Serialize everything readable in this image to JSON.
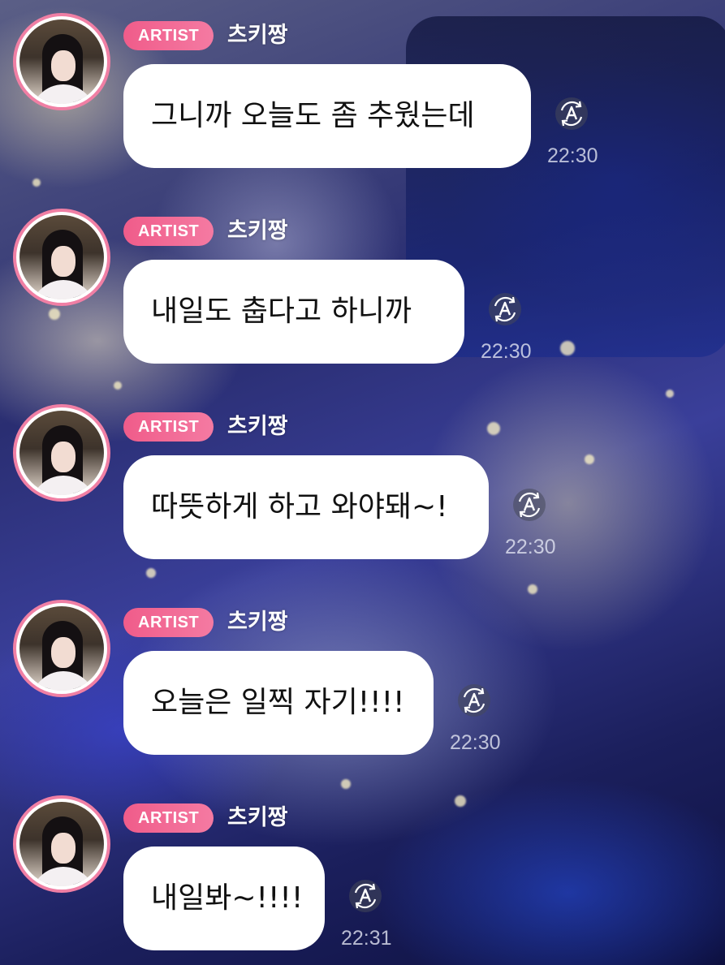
{
  "messages": [
    {
      "badge": "ARTIST",
      "name": "츠키짱",
      "text": "그니까 오늘도 좀 추웠는데",
      "time": "22:30"
    },
    {
      "badge": "ARTIST",
      "name": "츠키짱",
      "text": "내일도 춥다고 하니까",
      "time": "22:30"
    },
    {
      "badge": "ARTIST",
      "name": "츠키짱",
      "text": "따뜻하게 하고 와야돼~!",
      "time": "22:30"
    },
    {
      "badge": "ARTIST",
      "name": "츠키짱",
      "text": "오늘은 일찍 자기!!!!",
      "time": "22:30"
    },
    {
      "badge": "ARTIST",
      "name": "츠키짱",
      "text": "내일봐~!!!!",
      "time": "22:31"
    }
  ],
  "icons": {
    "avatar": "user-avatar-photo",
    "translate": "translate-icon"
  },
  "colors": {
    "badge_gradient_start": "#f05c8a",
    "badge_gradient_end": "#f47aa2",
    "avatar_ring": "#f07fa4",
    "bubble": "#ffffff",
    "message_text": "#111111"
  }
}
